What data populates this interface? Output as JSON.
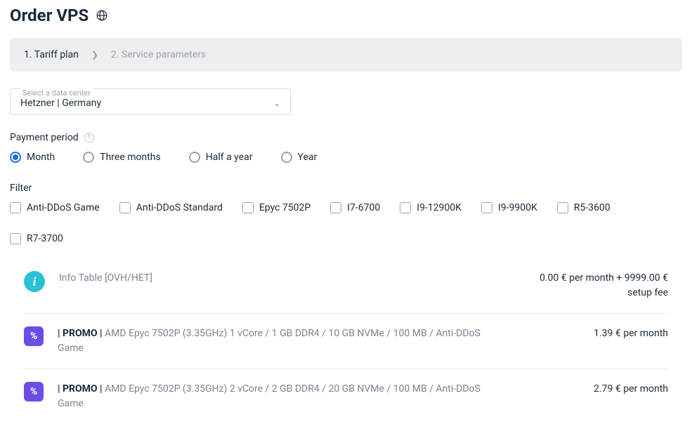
{
  "title": "Order VPS",
  "breadcrumb": {
    "step1": "1. Tariff plan",
    "step2": "2. Service parameters"
  },
  "datacenter": {
    "label": "Select a data center",
    "value": "Hetzner | Germany"
  },
  "payment": {
    "label": "Payment period",
    "options": [
      "Month",
      "Three months",
      "Half a year",
      "Year"
    ]
  },
  "filter": {
    "label": "Filter",
    "options": [
      "Anti-DDoS Game",
      "Anti-DDoS Standard",
      "Epyc 7502P",
      "I7-6700",
      "I9-12900K",
      "I9-9900K",
      "R5-3600",
      "R7-3700"
    ]
  },
  "plans": [
    {
      "icon": "info",
      "title": "Info Table [OVH/HET]",
      "spec": "",
      "price": "0.00 € per month + 9999.00 € setup fee"
    },
    {
      "icon": "promo",
      "title": "| PROMO | ",
      "spec": "AMD Epyc 7502P (3.35GHz) 1 vCore / 1 GB DDR4 / 10 GB NVMe / 100 MB / Anti-DDoS Game",
      "price": "1.39 € per month"
    },
    {
      "icon": "promo",
      "title": "| PROMO | ",
      "spec": "AMD Epyc 7502P (3.35GHz) 2 vCore / 2 GB DDR4 / 20 GB NVMe / 100 MB / Anti-DDoS Game",
      "price": "2.79 € per month"
    }
  ]
}
